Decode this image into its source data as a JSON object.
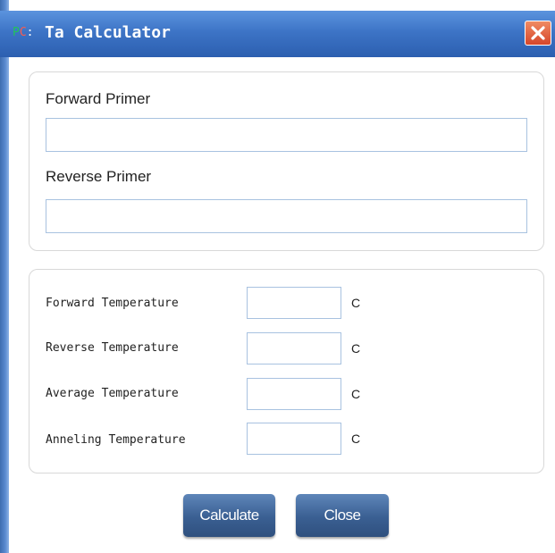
{
  "window": {
    "title": "Ta Calculator",
    "icon": "PC:",
    "close": "close-icon"
  },
  "primers": {
    "forward_label": "Forward Primer",
    "forward_value": "",
    "reverse_label": "Reverse Primer",
    "reverse_value": ""
  },
  "temperatures": [
    {
      "label": "Forward Temperature",
      "value": "",
      "unit": "C"
    },
    {
      "label": "Reverse Temperature",
      "value": "",
      "unit": "C"
    },
    {
      "label": "Average Temperature",
      "value": "",
      "unit": "C"
    },
    {
      "label": "Anneling Temperature",
      "value": "",
      "unit": "C"
    }
  ],
  "buttons": {
    "calculate": "Calculate",
    "close": "Close"
  },
  "colors": {
    "titlebar": "#3d74c6",
    "close_button": "#d6462a",
    "button": "#3a5f92",
    "input_border": "#a8c2e0"
  }
}
